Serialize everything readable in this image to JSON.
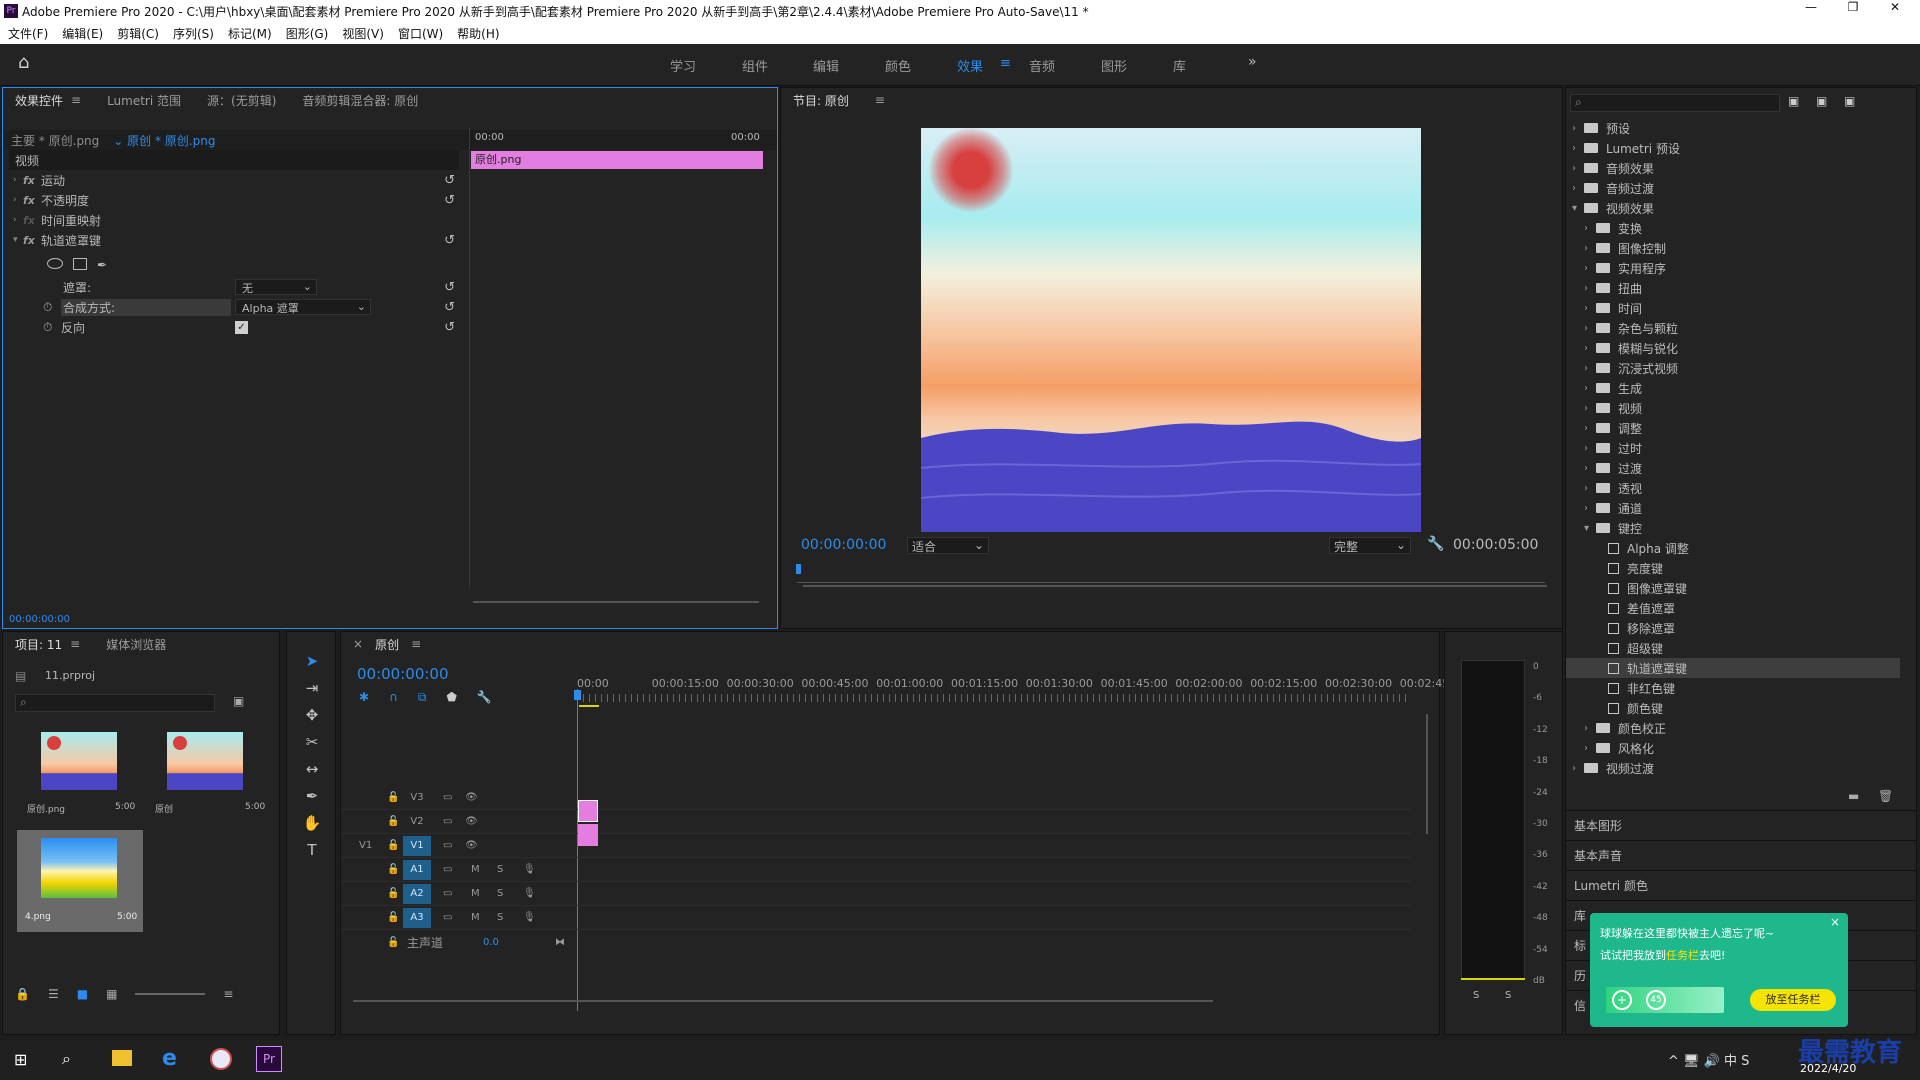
{
  "title": "Adobe Premiere Pro 2020 - C:\\用户\\hbxy\\桌面\\配套素材 Premiere Pro 2020 从新手到高手\\配套素材 Premiere Pro 2020 从新手到高手\\第2章\\2.4.4\\素材\\Adobe Premiere Pro Auto-Save\\11 *",
  "menu": [
    "文件(F)",
    "编辑(E)",
    "剪辑(C)",
    "序列(S)",
    "标记(M)",
    "图形(G)",
    "视图(V)",
    "窗口(W)",
    "帮助(H)"
  ],
  "workspaces": [
    "学习",
    "组件",
    "编辑",
    "颜色",
    "效果",
    "音频",
    "图形",
    "库"
  ],
  "workspace_more": "»",
  "effect_controls": {
    "tabs": [
      "效果控件",
      "Lumetri 范围",
      "源：(无剪辑)",
      "音频剪辑混合器: 原创"
    ],
    "master": "主要 * 原创.png",
    "clip": "原创 * 原创.png",
    "tl_start": "00:00",
    "tl_end": "00:00",
    "clip_label": "原创.png",
    "section": "视频",
    "effects": [
      "运动",
      "不透明度",
      "时间重映射",
      "轨道遮罩键"
    ],
    "mask_label": "遮罩:",
    "mask_value": "无",
    "composite_label": "合成方式:",
    "composite_value": "Alpha 遮罩",
    "reverse_label": "反向",
    "timecode": "00:00:00:00"
  },
  "program": {
    "title": "节目: 原创",
    "timecode": "00:00:00:00",
    "fit": "适合",
    "quality": "完整",
    "duration": "00:00:05:00"
  },
  "effects_panel": {
    "items": [
      {
        "label": "预设",
        "level": 0,
        "type": "folder"
      },
      {
        "label": "Lumetri 预设",
        "level": 0,
        "type": "folder"
      },
      {
        "label": "音频效果",
        "level": 0,
        "type": "folder"
      },
      {
        "label": "音频过渡",
        "level": 0,
        "type": "folder"
      },
      {
        "label": "视频效果",
        "level": 0,
        "type": "folder",
        "open": true
      },
      {
        "label": "变换",
        "level": 1,
        "type": "folder"
      },
      {
        "label": "图像控制",
        "level": 1,
        "type": "folder"
      },
      {
        "label": "实用程序",
        "level": 1,
        "type": "folder"
      },
      {
        "label": "扭曲",
        "level": 1,
        "type": "folder"
      },
      {
        "label": "时间",
        "level": 1,
        "type": "folder"
      },
      {
        "label": "杂色与颗粒",
        "level": 1,
        "type": "folder"
      },
      {
        "label": "模糊与锐化",
        "level": 1,
        "type": "folder"
      },
      {
        "label": "沉浸式视频",
        "level": 1,
        "type": "folder"
      },
      {
        "label": "生成",
        "level": 1,
        "type": "folder"
      },
      {
        "label": "视频",
        "level": 1,
        "type": "folder"
      },
      {
        "label": "调整",
        "level": 1,
        "type": "folder"
      },
      {
        "label": "过时",
        "level": 1,
        "type": "folder"
      },
      {
        "label": "过渡",
        "level": 1,
        "type": "folder"
      },
      {
        "label": "透视",
        "level": 1,
        "type": "folder"
      },
      {
        "label": "通道",
        "level": 1,
        "type": "folder"
      },
      {
        "label": "键控",
        "level": 1,
        "type": "folder",
        "open": true
      },
      {
        "label": "Alpha 调整",
        "level": 2,
        "type": "effect"
      },
      {
        "label": "亮度键",
        "level": 2,
        "type": "effect"
      },
      {
        "label": "图像遮罩键",
        "level": 2,
        "type": "effect"
      },
      {
        "label": "差值遮罩",
        "level": 2,
        "type": "effect"
      },
      {
        "label": "移除遮罩",
        "level": 2,
        "type": "effect"
      },
      {
        "label": "超级键",
        "level": 2,
        "type": "effect"
      },
      {
        "label": "轨道遮罩键",
        "level": 2,
        "type": "effect",
        "selected": true
      },
      {
        "label": "非红色键",
        "level": 2,
        "type": "effect"
      },
      {
        "label": "颜色键",
        "level": 2,
        "type": "effect"
      },
      {
        "label": "颜色校正",
        "level": 1,
        "type": "folder"
      },
      {
        "label": "风格化",
        "level": 1,
        "type": "folder"
      },
      {
        "label": "视频过渡",
        "level": 0,
        "type": "folder"
      }
    ],
    "sections": [
      "基本图形",
      "基本声音",
      "Lumetri 颜色",
      "库",
      "标",
      "历",
      "信"
    ]
  },
  "project": {
    "tabs": [
      "项目: 11",
      "媒体浏览器"
    ],
    "file": "11.prproj",
    "items": [
      {
        "name": "原创.png",
        "dur": "5:00"
      },
      {
        "name": "原创",
        "dur": "5:00"
      },
      {
        "name": "4.png",
        "dur": "5:00"
      }
    ]
  },
  "timeline": {
    "tab": "原创",
    "timecode": "00:00:00:00",
    "ruler": [
      "00:00",
      "00:00:15:00",
      "00:00:30:00",
      "00:00:45:00",
      "00:01:00:00",
      "00:01:15:00",
      "00:01:30:00",
      "00:01:45:00",
      "00:02:00:00",
      "00:02:15:00",
      "00:02:30:00",
      "00:02:45:"
    ],
    "vtracks": [
      "V3",
      "V2",
      "V1"
    ],
    "atracks": [
      "A1",
      "A2",
      "A3"
    ],
    "source_v": "V1",
    "master": "主声道",
    "master_val": "0.0",
    "m": "M",
    "s": "S"
  },
  "meter": {
    "ticks": [
      "0",
      "-6",
      "-12",
      "-18",
      "-24",
      "-30",
      "-36",
      "-42",
      "-48",
      "-54",
      "dB"
    ],
    "s": "S"
  },
  "popup": {
    "line1": "球球躲在这里都快被主人遗忘了呢~",
    "line2_a": "试试把我放到",
    "line2_b": "任务栏",
    "line2_c": "去吧!",
    "button": "放至任务栏",
    "close": "×",
    "badge": "45"
  },
  "taskbar": {
    "date": "2022/4/20",
    "watermark": "最需教育"
  },
  "colors": {
    "accent": "#2d8ceb",
    "clip": "#e37de0",
    "popup": "#1fb88c"
  }
}
